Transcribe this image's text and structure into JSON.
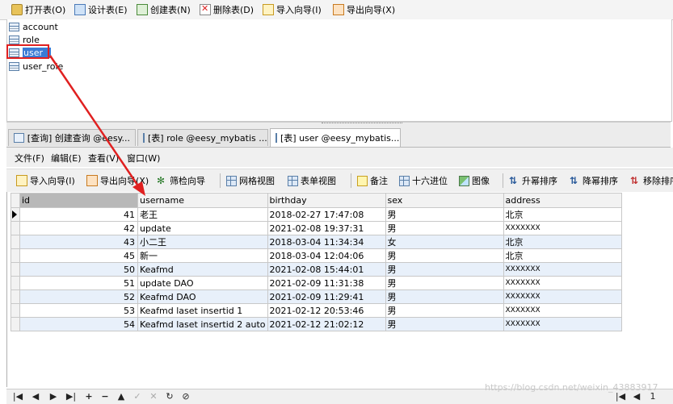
{
  "toolbar": {
    "open_table": "打开表(O)",
    "design_table": "设计表(E)",
    "create_table": "创建表(N)",
    "delete_table": "删除表(D)",
    "import_wizard": "导入向导(I)",
    "export_wizard": "导出向导(X)"
  },
  "tables": [
    "account",
    "role",
    "user",
    "user_role"
  ],
  "tabs": [
    {
      "label": "[查询] 创建查询 @eesy..."
    },
    {
      "label": "[表] role @eesy_mybatis ..."
    },
    {
      "label": "[表] user @eesy_mybatis..."
    }
  ],
  "menu": {
    "file": "文件(F)",
    "edit": "编辑(E)",
    "view": "查看(V)",
    "window": "窗口(W)"
  },
  "grid_toolbar": {
    "import_wizard": "导入向导(I)",
    "export_wizard": "导出向导(X)",
    "filter_wizard": "筛检向导",
    "grid_view": "网格视图",
    "form_view": "表单视图",
    "note": "备注",
    "hex": "十六进位",
    "image": "图像",
    "sort_asc": "升幂排序",
    "sort_desc": "降幂排序",
    "remove_sort": "移除排序"
  },
  "grid": {
    "columns": [
      "id",
      "username",
      "birthday",
      "sex",
      "address"
    ],
    "rows": [
      {
        "id": "41",
        "username": "老王",
        "birthday": "2018-02-27 17:47:08",
        "sex": "男",
        "address": "北京"
      },
      {
        "id": "42",
        "username": "update",
        "birthday": "2021-02-08 19:37:31",
        "sex": "男",
        "address": "XXXXXXX"
      },
      {
        "id": "43",
        "username": "小二王",
        "birthday": "2018-03-04 11:34:34",
        "sex": "女",
        "address": "北京"
      },
      {
        "id": "45",
        "username": "新一",
        "birthday": "2018-03-04 12:04:06",
        "sex": "男",
        "address": "北京"
      },
      {
        "id": "50",
        "username": "Keafmd",
        "birthday": "2021-02-08 15:44:01",
        "sex": "男",
        "address": "XXXXXXX"
      },
      {
        "id": "51",
        "username": "update DAO",
        "birthday": "2021-02-09 11:31:38",
        "sex": "男",
        "address": "XXXXXXX"
      },
      {
        "id": "52",
        "username": "Keafmd DAO",
        "birthday": "2021-02-09 11:29:41",
        "sex": "男",
        "address": "XXXXXXX"
      },
      {
        "id": "53",
        "username": "Keafmd laset insertid 1",
        "birthday": "2021-02-12 20:53:46",
        "sex": "男",
        "address": "XXXXXXX"
      },
      {
        "id": "54",
        "username": "Keafmd laset insertid 2 auto",
        "birthday": "2021-02-12 21:02:12",
        "sex": "男",
        "address": "XXXXXXX"
      }
    ]
  },
  "status": {
    "watermark": "https://blog.csdn.net/weixin_43883917",
    "page": "1"
  },
  "colors": {
    "annotation_red": "#e02020",
    "selection_blue": "#3a7bd5",
    "alt_row": "#e8f0fa"
  }
}
